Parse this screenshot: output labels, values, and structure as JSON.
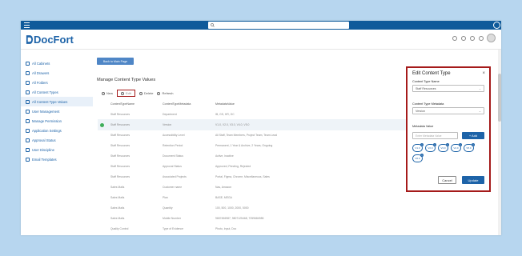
{
  "app": {
    "logo_text": "DocFort",
    "search_placeholder": ""
  },
  "sidebar": {
    "items": [
      {
        "label": "All Cabinets",
        "icon": "cabinet-icon"
      },
      {
        "label": "All Drawers",
        "icon": "drawer-icon"
      },
      {
        "label": "All Folders",
        "icon": "folder-icon"
      },
      {
        "label": "All Content Types",
        "icon": "content-types-icon"
      },
      {
        "label": "All Content Type Values",
        "icon": "content-values-icon",
        "active": true
      },
      {
        "label": "User Management",
        "icon": "users-icon"
      },
      {
        "label": "Manage Permission",
        "icon": "permission-icon"
      },
      {
        "label": "Application Settings",
        "icon": "settings-icon"
      },
      {
        "label": "Approval Status",
        "icon": "approval-icon"
      },
      {
        "label": "User Discipline",
        "icon": "discipline-icon"
      },
      {
        "label": "Email Templates",
        "icon": "email-icon"
      }
    ]
  },
  "main": {
    "back_button": "Back to Main Page",
    "title": "Manage Content Type Values",
    "toolbar": {
      "new": "New",
      "edit": "Edit",
      "delete": "Delete",
      "refresh": "Refresh"
    },
    "columns": [
      "ContentTypeName",
      "ContentTypeMetadata",
      "MetadataValue"
    ],
    "rows": [
      [
        "Staff Resources",
        "Department",
        "IB, GS, HR, GC"
      ],
      [
        "Staff Resources",
        "Version",
        "V1.0, V2.0, V3.0, V4.0, V5.0"
      ],
      [
        "Staff Resources",
        "Accessibility Level",
        "All Staff, Team Members, Project Team, Team Lead"
      ],
      [
        "Staff Resources",
        "Retention Period",
        "Permanent, 1 Year & Archive, 2 Years, Ongoing"
      ],
      [
        "Staff Resources",
        "Document Status",
        "Active, Inactive"
      ],
      [
        "Staff Resources",
        "Approval Status",
        "Approved, Pending, Rejected"
      ],
      [
        "Staff Resources",
        "Associated Projects",
        "Portal, Figma, Chrome, Miscellaneous, Sales"
      ],
      [
        "Sales Mails",
        "Customer name",
        "Nas, Amazon"
      ],
      [
        "Sales Mails",
        "Plan",
        "BASE, MEGA"
      ],
      [
        "Sales Mails",
        "Quantity",
        "100, 500, 1000, 2000, 5000"
      ],
      [
        "Sales Mails",
        "Mobile Number",
        "9657456987, 9807125468, 7259684985"
      ],
      [
        "Quality Control",
        "Type of Evidence",
        "Photo, Input, Doc"
      ]
    ]
  },
  "modal": {
    "title": "Edit Content Type",
    "close_label": "×",
    "type_name_label": "Content Type Name",
    "type_name_value": "Staff Resources",
    "metadata_label": "Content Type Metadata",
    "metadata_value": "Version",
    "value_label": "Metadata Value",
    "value_placeholder": "Enter Metadata Value",
    "add_label": "+ Add",
    "chips": [
      "V1.0",
      "V2.0",
      "V3.0",
      "V4.0",
      "V5.0",
      "V6.0"
    ],
    "cancel_label": "Cancel",
    "update_label": "Update"
  },
  "colors": {
    "topbar": "#0f5a9a",
    "accent": "#1d63a8",
    "highlight": "#a51a1a",
    "background": "#b7d6ef"
  }
}
